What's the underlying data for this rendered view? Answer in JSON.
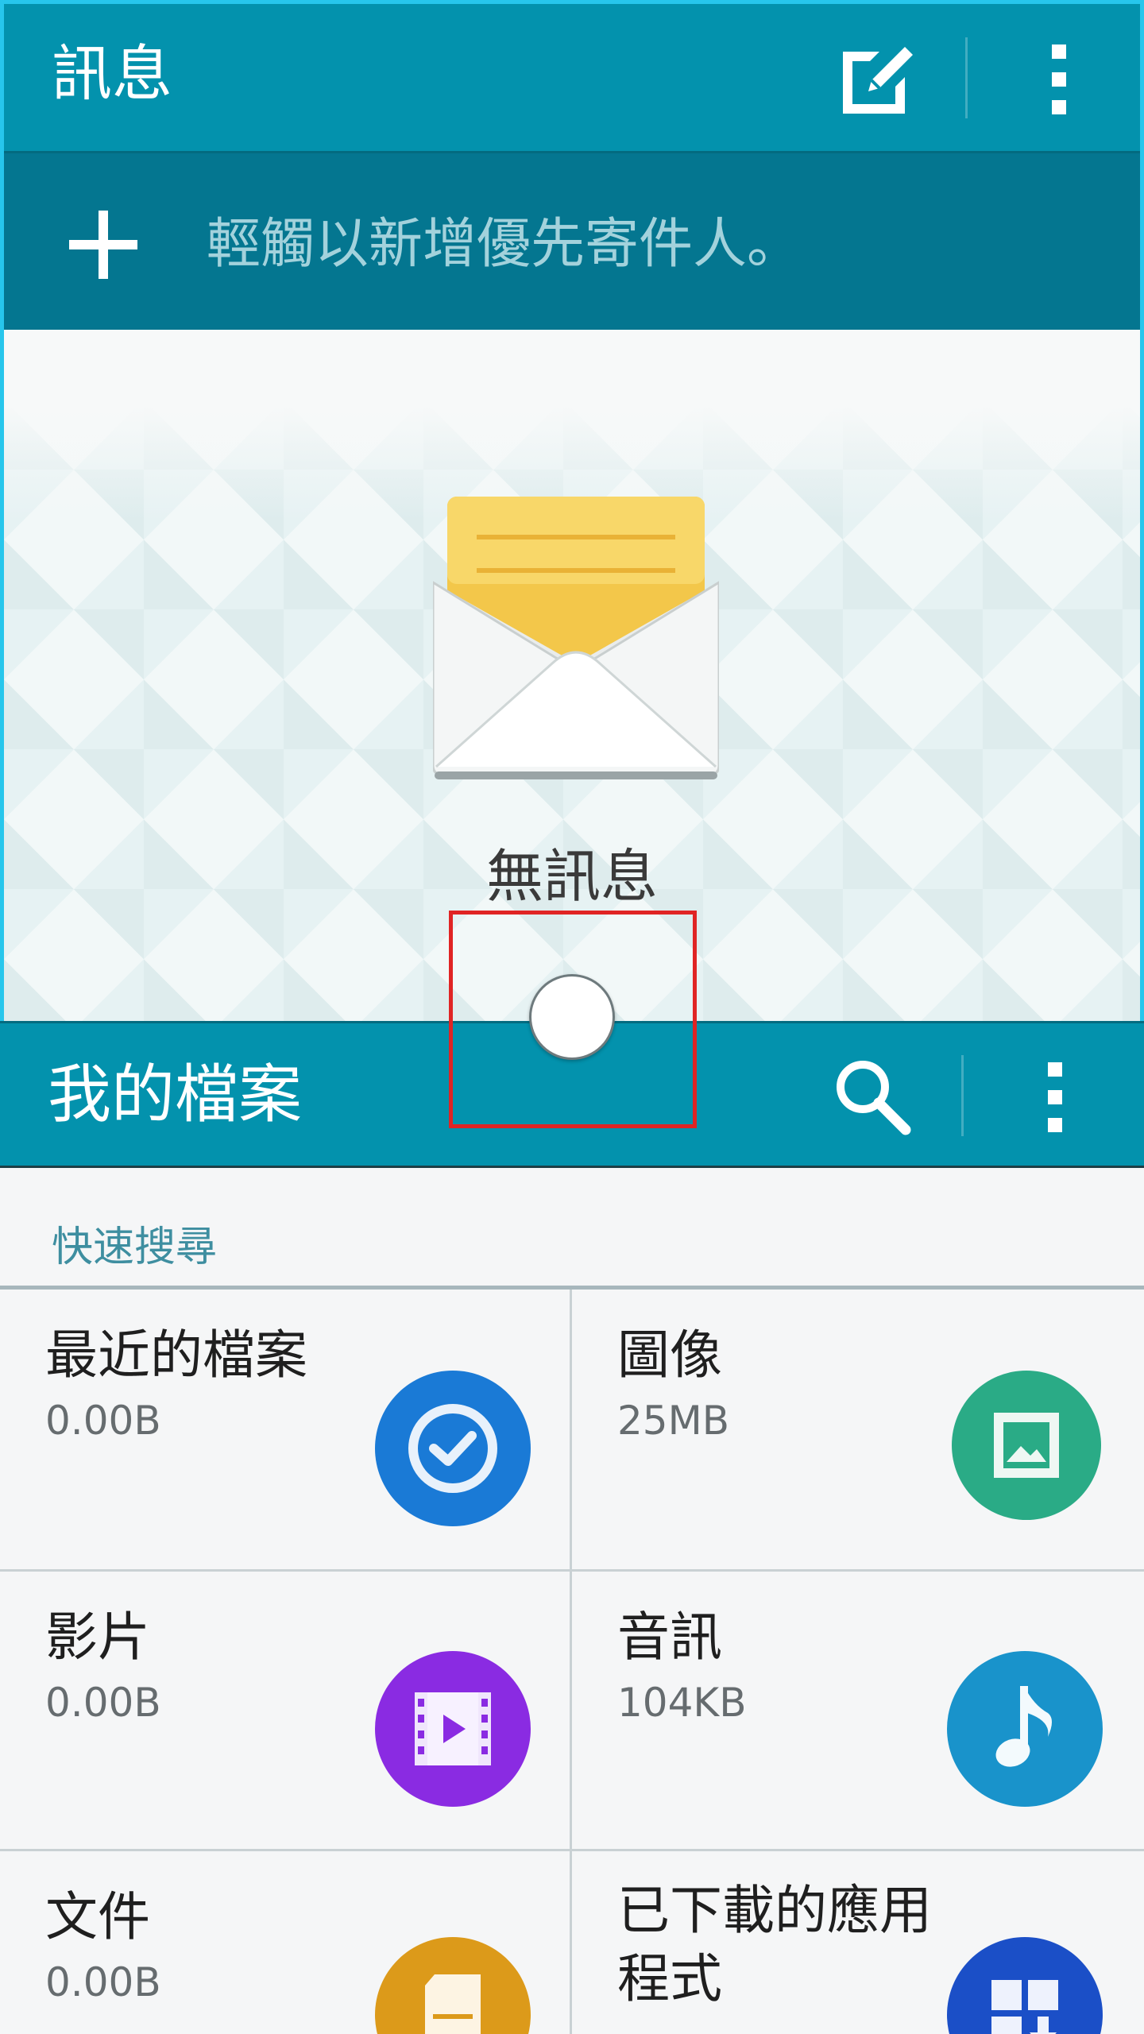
{
  "messages": {
    "title": "訊息",
    "priority_prompt": "輕觸以新增優先寄件人。",
    "empty_text": "無訊息",
    "icons": [
      "compose-icon",
      "more-vert-icon",
      "plus-icon",
      "envelope-icon"
    ]
  },
  "files": {
    "title": "我的檔案",
    "quick_search_label": "快速搜尋",
    "categories": [
      {
        "name": "最近的檔案",
        "size": "0.00B",
        "icon": "recent-check-icon",
        "color": "#1a7ad6"
      },
      {
        "name": "圖像",
        "size": "25MB",
        "icon": "image-icon",
        "color": "#2aab86"
      },
      {
        "name": "影片",
        "size": "0.00B",
        "icon": "video-icon",
        "color": "#8a2be2"
      },
      {
        "name": "音訊",
        "size": "104KB",
        "icon": "music-note-icon",
        "color": "#1993cb"
      },
      {
        "name": "文件",
        "size": "0.00B",
        "icon": "document-icon",
        "color": "#dc9a1a"
      },
      {
        "name": "已下載的應用\n程式",
        "size": "",
        "icon": "downloaded-apps-icon",
        "color": "#1b4fc7"
      }
    ]
  },
  "colors": {
    "header_teal": "#0392ad",
    "priority_bar": "#047690",
    "window_border": "#27c6ec",
    "focus_box": "#e02424"
  }
}
